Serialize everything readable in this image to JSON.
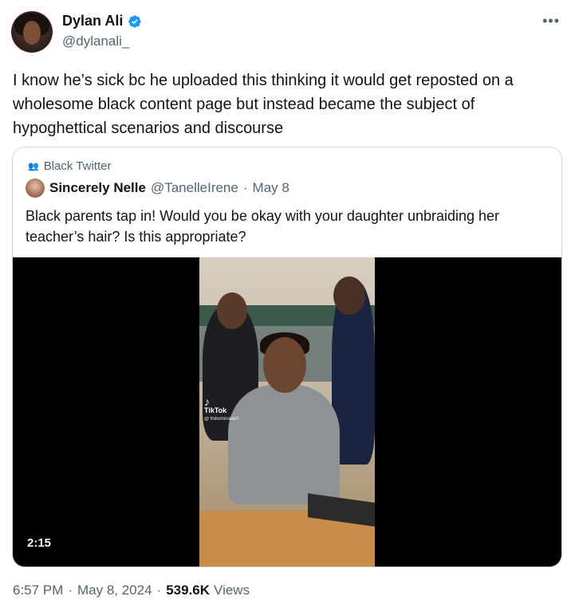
{
  "author": {
    "name": "Dylan Ali",
    "handle": "@dylanali_",
    "verified_color": "#1d9bf0"
  },
  "more_icon": "more-horizontal-icon",
  "tweet": {
    "text": "I know he’s sick bc he uploaded this thinking it would get reposted on a wholesome black content page but instead became the subject of hypoghettical scenarios and discourse"
  },
  "quoted": {
    "community": "Black Twitter",
    "community_icon": "community-icon",
    "name": "Sincerely Nelle",
    "handle": "@TanelleIrene",
    "separator": "·",
    "date": "May 8",
    "text": "Black parents tap in! Would you be okay with your daughter unbraiding her teacher’s hair? Is this appropriate?",
    "video": {
      "duration": "2:15",
      "watermark": "TikTok",
      "watermark_user": "@ thilluminatiart"
    }
  },
  "meta": {
    "time": "6:57 PM",
    "date": "May 8, 2024",
    "views_count": "539.6K",
    "views_label": "Views"
  }
}
